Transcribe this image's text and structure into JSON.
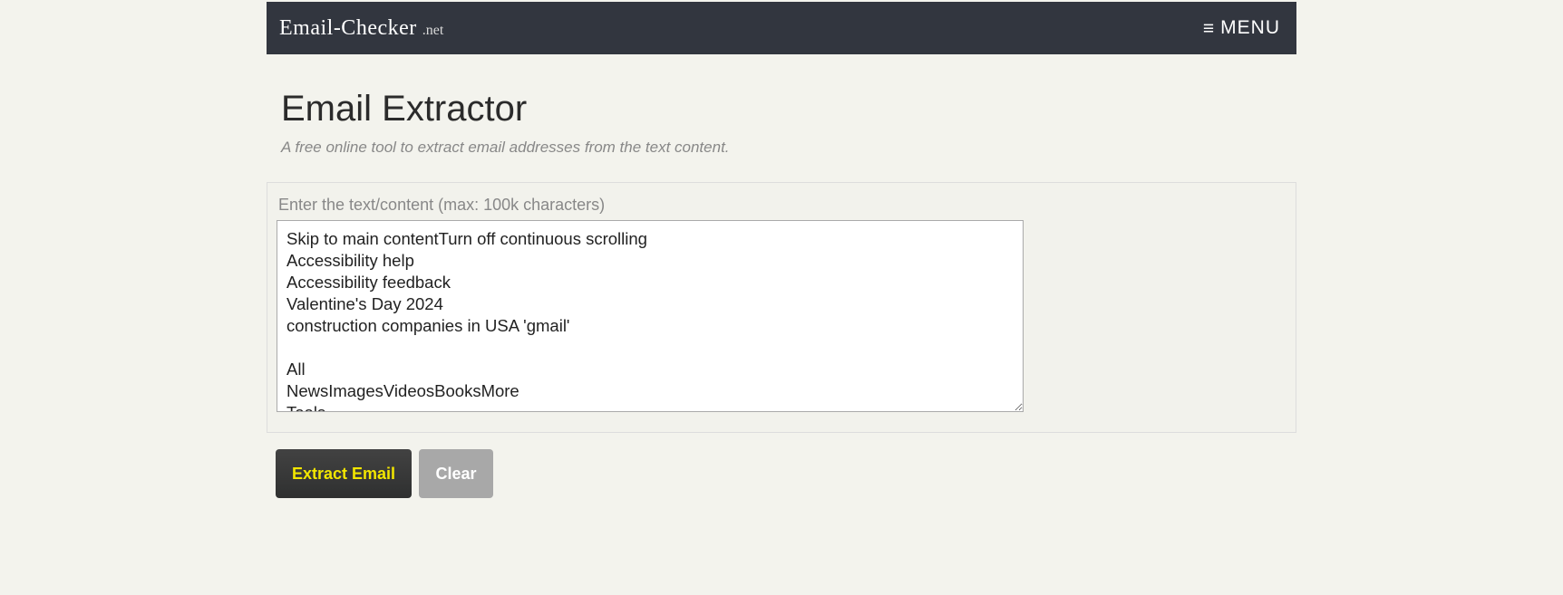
{
  "header": {
    "logo_main": "Email-Checker",
    "logo_suffix": ".net",
    "menu_label": "MENU"
  },
  "page": {
    "title": "Email Extractor",
    "subtitle": "A free online tool to extract email addresses from the text content."
  },
  "panel": {
    "label": "Enter the text/content (max: 100k characters)",
    "textarea_value": "Skip to main contentTurn off continuous scrolling\nAccessibility help\nAccessibility feedback\nValentine's Day 2024\nconstruction companies in USA 'gmail'\n\nAll\nNewsImagesVideosBooksMore\nTools"
  },
  "buttons": {
    "extract_label": "Extract Email",
    "clear_label": "Clear"
  }
}
